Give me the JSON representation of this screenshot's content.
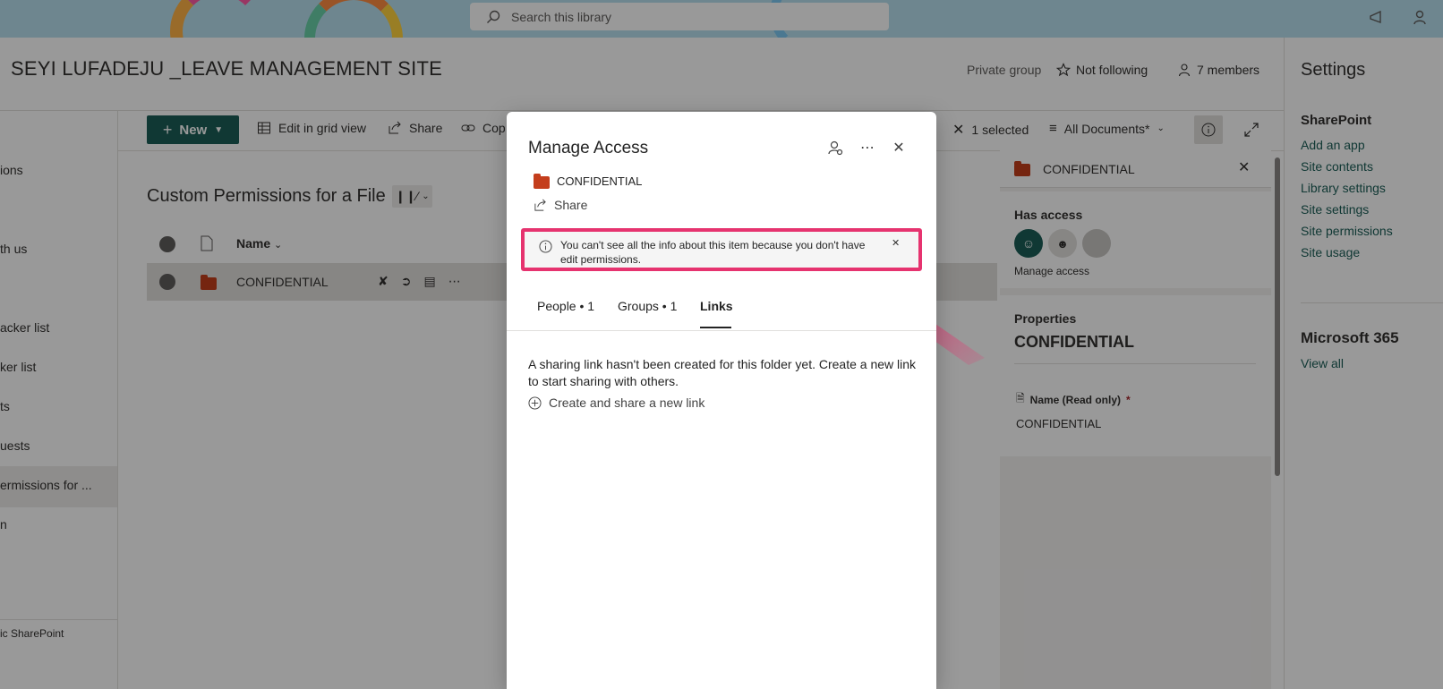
{
  "topbar": {
    "search_placeholder": "Search this library"
  },
  "site": {
    "title": "SEYI LUFADEJU _LEAVE MANAGEMENT SITE",
    "privacy": "Private group",
    "follow": "Not following",
    "members": "7 members"
  },
  "leftnav": {
    "items": [
      {
        "label": "ions"
      },
      {
        "label": "th us"
      },
      {
        "label": "acker list"
      },
      {
        "label": "ker list"
      },
      {
        "label": "ts"
      },
      {
        "label": "uests"
      },
      {
        "label": "ermissions for ..."
      },
      {
        "label": "n"
      }
    ],
    "footer": "ic SharePoint"
  },
  "commandbar": {
    "new": "New",
    "grid": "Edit in grid view",
    "share": "Share",
    "copy": "Cop",
    "selected": "1 selected",
    "view": "All Documents*"
  },
  "library": {
    "title": "Custom Permissions for a File",
    "column_name": "Name",
    "row_name": "CONFIDENTIAL"
  },
  "details": {
    "title": "CONFIDENTIAL",
    "has_access": "Has access",
    "manage_access": "Manage access",
    "properties": "Properties",
    "prop_title": "CONFIDENTIAL",
    "name_label": "Name (Read only)",
    "required_mark": "*",
    "name_value": "CONFIDENTIAL"
  },
  "settings": {
    "title": "Settings",
    "sharepoint": "SharePoint",
    "links": [
      "Add an app",
      "Site contents",
      "Library settings",
      "Site settings",
      "Site permissions",
      "Site usage"
    ],
    "m365": "Microsoft 365",
    "view_all": "View all"
  },
  "dialog": {
    "title": "Manage Access",
    "item_name": "CONFIDENTIAL",
    "share": "Share",
    "warning": "You can't see all the info about this item because you don't have edit permissions.",
    "tabs": [
      "People • 1",
      "Groups • 1",
      "Links"
    ],
    "active_tab": "Links",
    "description": "A sharing link hasn't been created for this folder yet. Create a new link to start sharing with others.",
    "create_link": "Create and share a new link"
  },
  "colors": {
    "accent": "#1b5e57",
    "highlight": "#e6336f",
    "folder": "#c43e1c"
  }
}
